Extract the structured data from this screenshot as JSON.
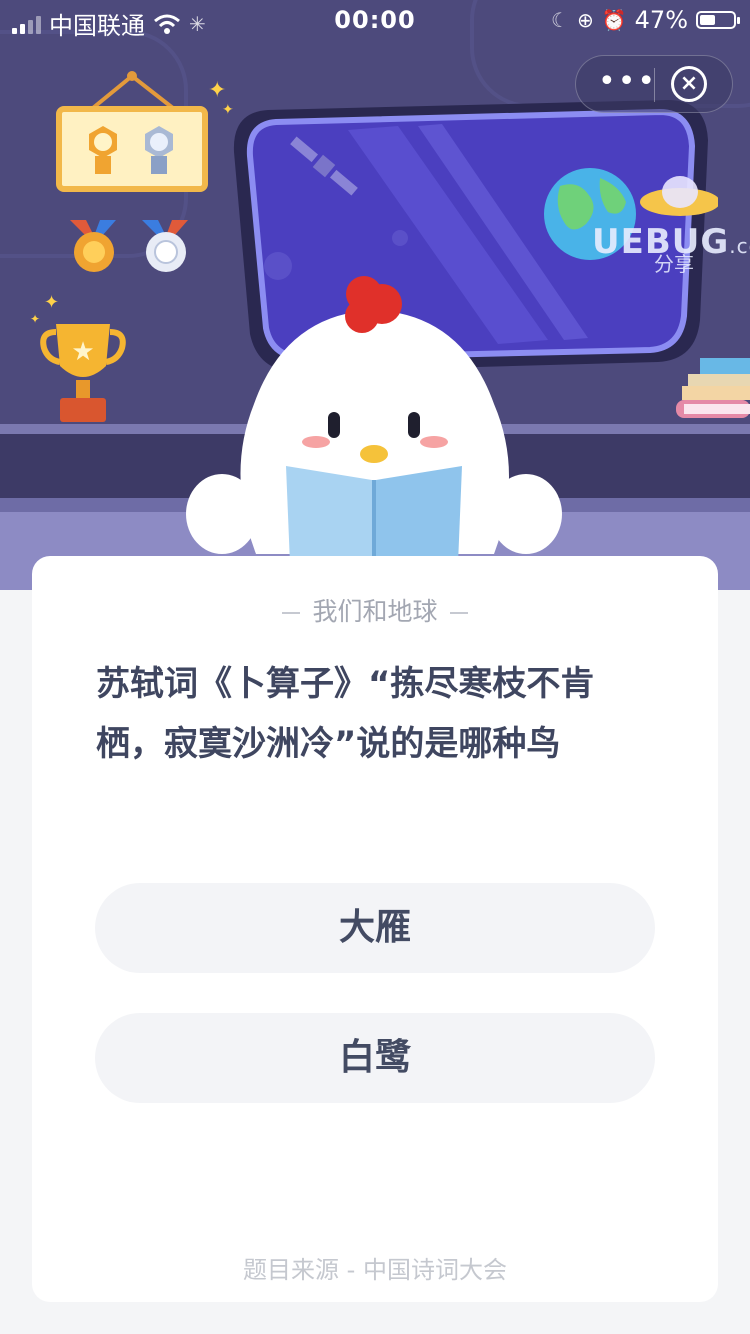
{
  "status_bar": {
    "carrier": "中国联通",
    "time": "00:00",
    "battery_percent": "47%",
    "battery_level": 0.47
  },
  "capsule": {
    "more_label": "•••",
    "close_label": "×"
  },
  "illustration": {
    "watermark_main": "UEBUG",
    "watermark_suffix": ".com",
    "watermark_sub": "分享"
  },
  "quiz": {
    "category": "我们和地球",
    "question": "苏轼词《卜算子》“拣尽寒枝不肯栖，寂寞沙洲冷”说的是哪种鸟",
    "options": [
      "大雁",
      "白鹭"
    ],
    "source": "题目来源 - 中国诗词大会"
  },
  "colors": {
    "scene_bg": "#4d4a7c",
    "window_glass": "#4b3fbf",
    "card_bg": "#ffffff",
    "option_bg": "#f3f4f7",
    "text_primary": "#3f4660",
    "comb_red": "#e0302a",
    "book_blue": "#a9d3f2"
  }
}
